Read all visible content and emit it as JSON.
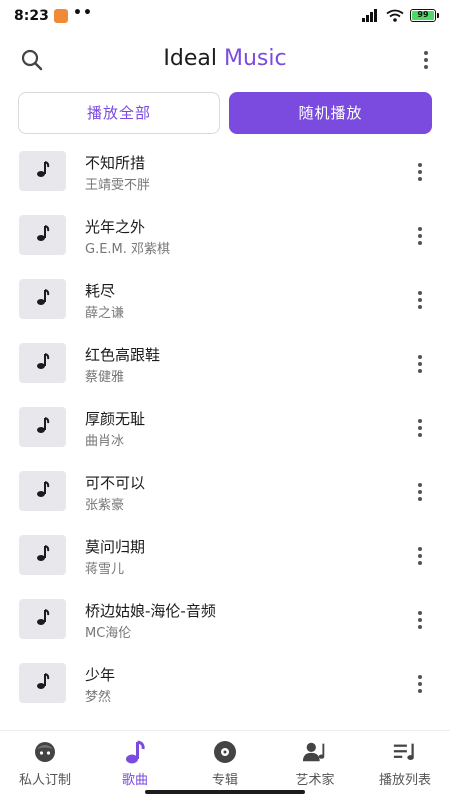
{
  "status_bar": {
    "time": "8:23",
    "dots": "••",
    "battery": "99"
  },
  "header": {
    "title_part1": "Ideal",
    "title_part2": "Music"
  },
  "actions": {
    "play_all": "播放全部",
    "shuffle": "随机播放"
  },
  "songs": [
    {
      "title": "不知所措",
      "artist": "王靖雯不胖"
    },
    {
      "title": "光年之外",
      "artist": "G.E.M. 邓紫棋"
    },
    {
      "title": "耗尽",
      "artist": "薛之谦"
    },
    {
      "title": "红色高跟鞋",
      "artist": "蔡健雅"
    },
    {
      "title": "厚颜无耻",
      "artist": "曲肖冰"
    },
    {
      "title": "可不可以",
      "artist": "张紫豪"
    },
    {
      "title": "莫问归期",
      "artist": "蒋雪儿"
    },
    {
      "title": "桥边姑娘-海伦-音频",
      "artist": "MC海伦"
    },
    {
      "title": "少年",
      "artist": "梦然"
    }
  ],
  "nav": [
    {
      "label": "私人订制",
      "icon": "face-icon",
      "active": false
    },
    {
      "label": "歌曲",
      "icon": "music-note-icon",
      "active": true
    },
    {
      "label": "专辑",
      "icon": "disc-icon",
      "active": false
    },
    {
      "label": "艺术家",
      "icon": "artist-icon",
      "active": false
    },
    {
      "label": "播放列表",
      "icon": "playlist-icon",
      "active": false
    }
  ],
  "colors": {
    "accent": "#7b4be0",
    "cover_bg": "#e8e8ec",
    "text_secondary": "#777777"
  }
}
